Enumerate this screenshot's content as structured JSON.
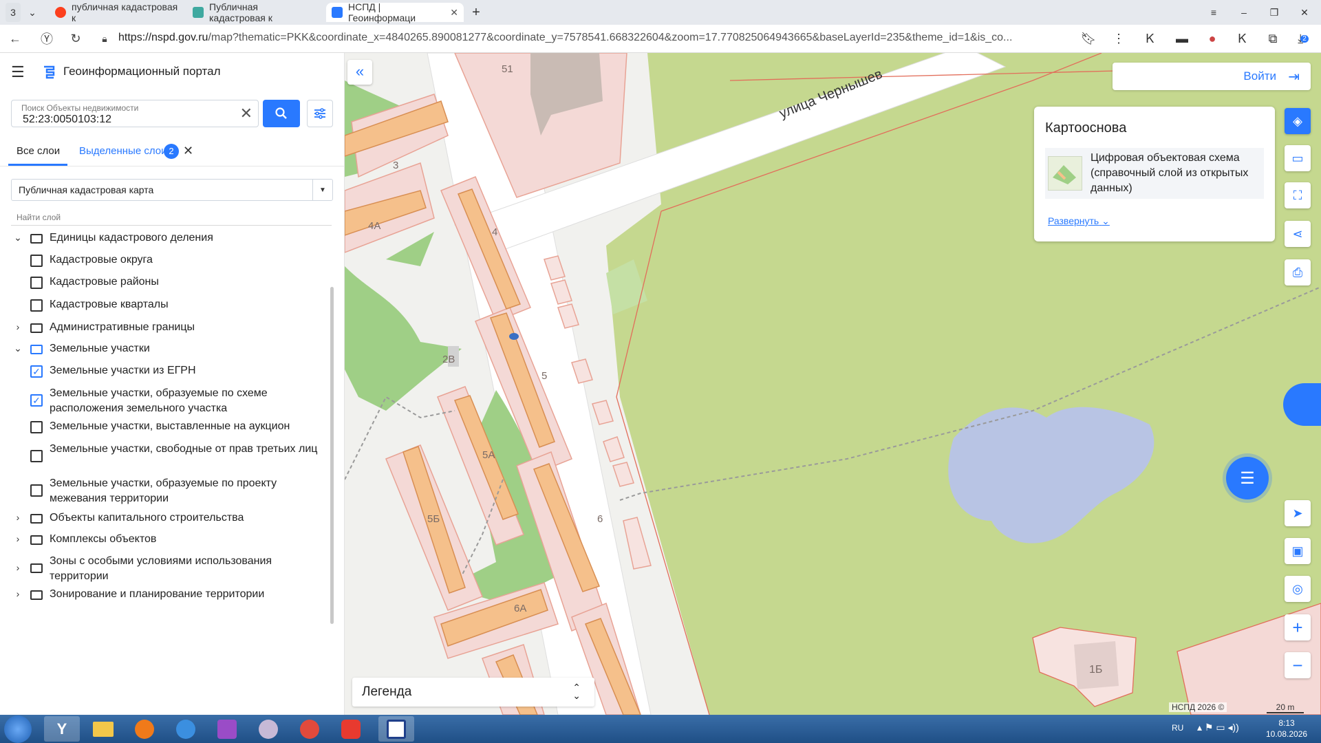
{
  "browser": {
    "tab_count": "3",
    "tabs": [
      {
        "label": "публичная кадастровая к"
      },
      {
        "label": "Публичная кадастровая к"
      },
      {
        "label": "НСПД | Геоинформаци"
      }
    ],
    "url_host": "https://nspd.gov.ru",
    "url_rest": "/map?thematic=PKK&coordinate_x=4840265.890081277&coordinate_y=7578541.668322604&zoom=17.770825064943665&baseLayerId=235&theme_id=1&is_co...",
    "downloads_badge": "2"
  },
  "sidebar": {
    "title": "Геоинформационный портал",
    "search": {
      "label": "Поиск Объекты недвижимости",
      "value": "52:23:0050103:12"
    },
    "tabs": {
      "all": "Все слои",
      "selected": "Выделенные слои",
      "selected_count": "2"
    },
    "layer_select": "Публичная кадастровая карта",
    "layer_search_placeholder": "Найти слой",
    "tree": [
      {
        "type": "folder",
        "expanded": true,
        "label": "Единицы кадастрового деления"
      },
      {
        "type": "check",
        "checked": false,
        "label": "Кадастровые округа"
      },
      {
        "type": "check",
        "checked": false,
        "label": "Кадастровые районы"
      },
      {
        "type": "check",
        "checked": false,
        "label": "Кадастровые кварталы"
      },
      {
        "type": "folder",
        "expanded": false,
        "label": "Административные границы"
      },
      {
        "type": "folder",
        "expanded": true,
        "label": "Земельные участки"
      },
      {
        "type": "check",
        "checked": true,
        "label": "Земельные участки из ЕГРН"
      },
      {
        "type": "check",
        "checked": true,
        "label": "Земельные участки, образуемые по схеме расположения земельного участка"
      },
      {
        "type": "check",
        "checked": false,
        "label": "Земельные участки, выставленные на аукцион"
      },
      {
        "type": "check",
        "checked": false,
        "label": "Земельные участки, свободные от прав третьих лиц"
      },
      {
        "type": "check",
        "checked": false,
        "label": "Земельные участки, образуемые по проекту межевания территории"
      },
      {
        "type": "folder",
        "expanded": false,
        "label": "Объекты капитального строительства"
      },
      {
        "type": "folder",
        "expanded": false,
        "label": "Комплексы объектов"
      },
      {
        "type": "folder",
        "expanded": false,
        "label": "Зоны с особыми условиями использования территории"
      },
      {
        "type": "folder",
        "expanded": false,
        "label": "Зонирование и планирование территории"
      }
    ]
  },
  "map": {
    "street_label": "улица Чернышев",
    "building_labels": [
      "51",
      "3",
      "4А",
      "4",
      "2В",
      "5",
      "5А",
      "5Б",
      "6",
      "6А",
      "1Б"
    ],
    "login_label": "Войти",
    "basemap": {
      "title": "Картооснова",
      "item": "Цифровая объектовая схема (справочный слой из открытых данных)",
      "expand": "Развернуть"
    },
    "legend": "Легенда",
    "copyright": "НСПД 2026 ©",
    "scale": "20 m"
  },
  "taskbar": {
    "lang": "RU",
    "time": "8:13",
    "date": "10.08.2026"
  }
}
